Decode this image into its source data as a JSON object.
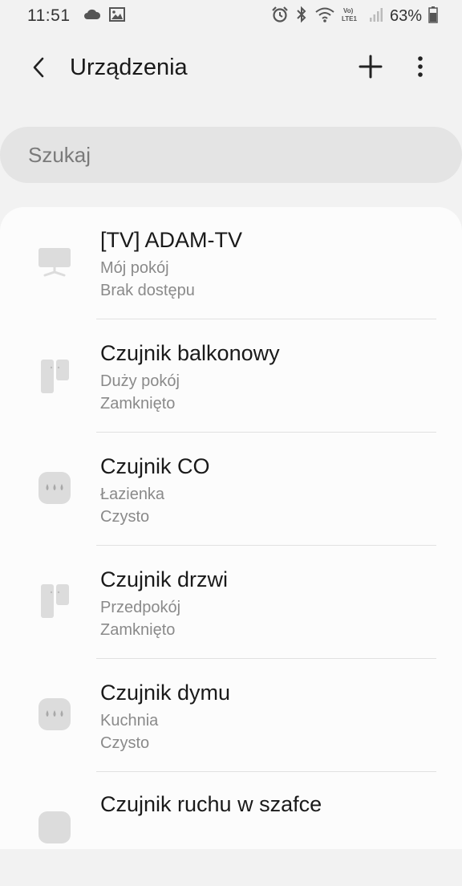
{
  "status_bar": {
    "time": "11:51",
    "battery_percent": "63%",
    "icons": [
      "cloud-icon",
      "image-icon",
      "alarm-icon",
      "bluetooth-icon",
      "wifi-icon",
      "volte-icon",
      "signal-icon",
      "battery-icon"
    ]
  },
  "header": {
    "title": "Urządzenia",
    "back_icon": "chevron-left-icon",
    "add_icon": "plus-icon",
    "more_icon": "more-vertical-icon"
  },
  "search": {
    "placeholder": "Szukaj"
  },
  "devices": [
    {
      "name": "[TV] ADAM-TV",
      "room": "Mój pokój",
      "status": "Brak dostępu",
      "icon": "tv-icon"
    },
    {
      "name": "Czujnik balkonowy",
      "room": "Duży pokój",
      "status": "Zamknięto",
      "icon": "contact-sensor-icon"
    },
    {
      "name": "Czujnik CO",
      "room": "Łazienka",
      "status": "Czysto",
      "icon": "co-sensor-icon"
    },
    {
      "name": "Czujnik drzwi",
      "room": "Przedpokój",
      "status": "Zamknięto",
      "icon": "contact-sensor-icon"
    },
    {
      "name": "Czujnik dymu",
      "room": "Kuchnia",
      "status": "Czysto",
      "icon": "smoke-sensor-icon"
    },
    {
      "name": "Czujnik ruchu w szafce",
      "room": "",
      "status": "",
      "icon": "motion-sensor-icon"
    }
  ],
  "colors": {
    "background": "#f2f2f2",
    "card": "#fcfcfc",
    "search_bg": "#e4e4e4",
    "primary_text": "#1a1a1a",
    "secondary_text": "#8a8a8a",
    "icon_gray": "#dcdcdc"
  }
}
